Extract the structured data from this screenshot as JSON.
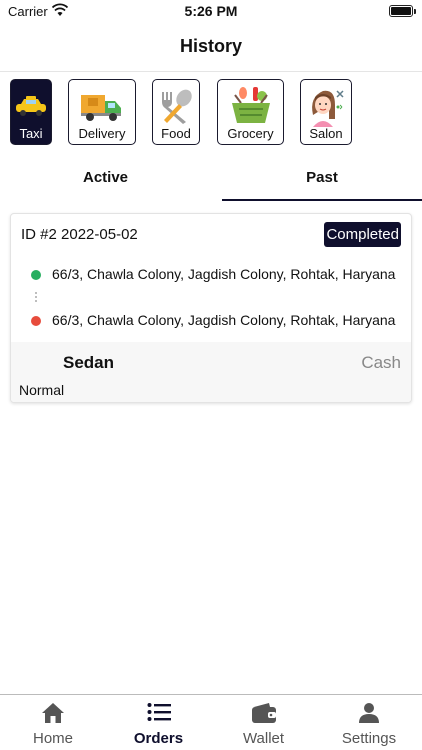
{
  "status_bar": {
    "carrier": "Carrier",
    "time": "5:26 PM"
  },
  "header": {
    "title": "History"
  },
  "categories": [
    {
      "label": "Taxi",
      "icon": "taxi-icon",
      "active": true
    },
    {
      "label": "Delivery",
      "icon": "delivery-truck-icon",
      "active": false
    },
    {
      "label": "Food",
      "icon": "food-utensils-icon",
      "active": false
    },
    {
      "label": "Grocery",
      "icon": "grocery-basket-icon",
      "active": false
    },
    {
      "label": "Salon",
      "icon": "salon-icon",
      "active": false
    }
  ],
  "tabs": [
    {
      "label": "Active",
      "active": false
    },
    {
      "label": "Past",
      "active": true
    }
  ],
  "orders": [
    {
      "id": "ID #2 2022-05-02",
      "status": "Completed",
      "pickup": "66/3, Chawla Colony, Jagdish Colony, Rohtak, Haryana",
      "dropoff": "66/3, Chawla Colony, Jagdish Colony, Rohtak, Haryana",
      "vehicle": "Sedan",
      "payment": "Cash",
      "ride_type": "Normal"
    }
  ],
  "bottom_nav": [
    {
      "label": "Home",
      "icon": "home-icon",
      "active": false
    },
    {
      "label": "Orders",
      "icon": "list-icon",
      "active": true
    },
    {
      "label": "Wallet",
      "icon": "wallet-icon",
      "active": false
    },
    {
      "label": "Settings",
      "icon": "user-icon",
      "active": false
    }
  ],
  "colors": {
    "accent": "#0f0f2d",
    "pickup_dot": "#27ae60",
    "dropoff_dot": "#e74c3c",
    "muted_text": "#888888"
  }
}
